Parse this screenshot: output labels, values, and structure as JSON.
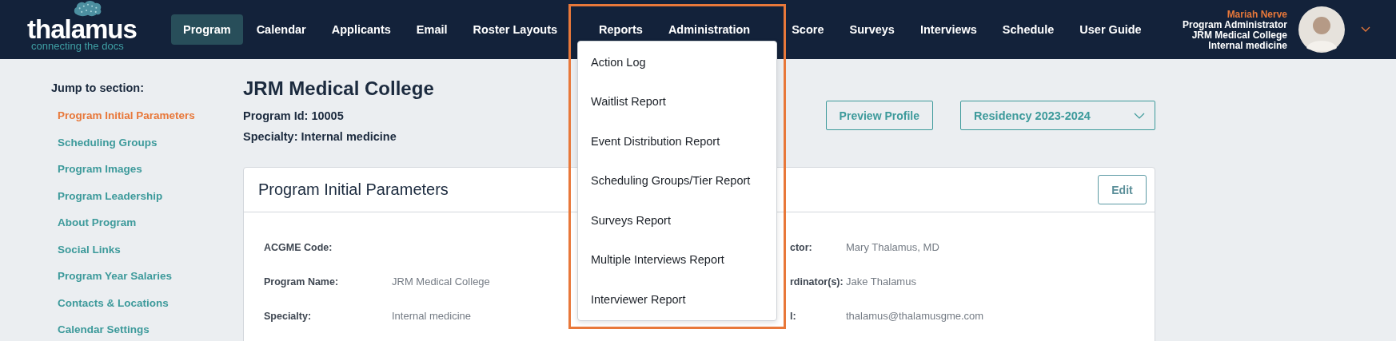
{
  "logo": {
    "name": "thalamus",
    "tagline": "connecting the docs"
  },
  "nav": [
    {
      "label": "Program",
      "selected": true
    },
    {
      "label": "Calendar",
      "selected": false
    },
    {
      "label": "Applicants",
      "selected": false
    },
    {
      "label": "Email",
      "selected": false
    },
    {
      "label": "Roster Layouts",
      "selected": false
    },
    {
      "label": "Reports",
      "selected": false
    },
    {
      "label": "Administration",
      "selected": false
    },
    {
      "label": "Score",
      "selected": false
    },
    {
      "label": "Surveys",
      "selected": false
    },
    {
      "label": "Interviews",
      "selected": false
    },
    {
      "label": "Schedule",
      "selected": false
    },
    {
      "label": "User Guide",
      "selected": false
    }
  ],
  "user": {
    "name": "Mariah Nerve",
    "role": "Program Administrator",
    "institution": "JRM Medical College",
    "specialty": "Internal medicine"
  },
  "sidebar": {
    "heading": "Jump to section:",
    "items": [
      {
        "label": "Program Initial Parameters",
        "selected": true
      },
      {
        "label": "Scheduling Groups",
        "selected": false
      },
      {
        "label": "Program Images",
        "selected": false
      },
      {
        "label": "Program Leadership",
        "selected": false
      },
      {
        "label": "About Program",
        "selected": false
      },
      {
        "label": "Social Links",
        "selected": false
      },
      {
        "label": "Program Year Salaries",
        "selected": false
      },
      {
        "label": "Contacts & Locations",
        "selected": false
      },
      {
        "label": "Calendar Settings",
        "selected": false
      }
    ]
  },
  "program": {
    "title": "JRM Medical College",
    "id_line": "Program Id: 10005",
    "specialty_line": "Specialty: Internal medicine"
  },
  "preview_button": "Preview Profile",
  "season_select": {
    "value": "Residency 2023-2024"
  },
  "card": {
    "title": "Program Initial Parameters",
    "edit_button": "Edit",
    "rows": [
      {
        "label": "ACGME Code:",
        "right_label": "ctor:",
        "right_value": "Mary Thalamus, MD"
      },
      {
        "label": "Program Name:",
        "value": "JRM Medical College",
        "right_label": "rdinator(s):",
        "right_value": "Jake Thalamus"
      },
      {
        "label": "Specialty:",
        "value": "Internal medicine",
        "right_label": "l:",
        "right_value": "thalamus@thalamusgme.com"
      }
    ]
  },
  "reports_menu": {
    "items": [
      "Action Log",
      "Waitlist Report",
      "Event Distribution Report",
      "Scheduling Groups/Tier Report",
      "Surveys Report",
      "Multiple Interviews Report",
      "Interviewer Report"
    ]
  }
}
